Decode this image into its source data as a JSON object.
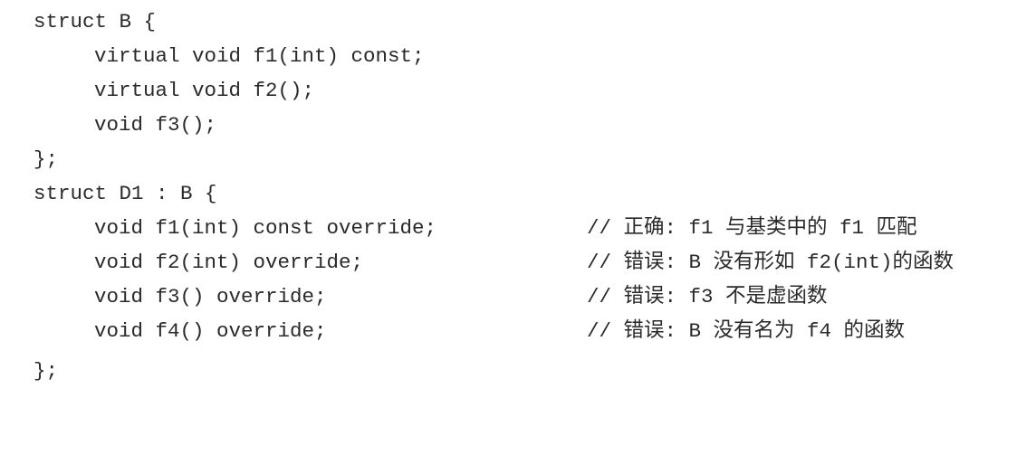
{
  "code": {
    "lines": [
      {
        "text": "struct B {",
        "comment": ""
      },
      {
        "text": "virtual void f1(int) const;",
        "comment": ""
      },
      {
        "text": "virtual void f2();",
        "comment": ""
      },
      {
        "text": "void f3();",
        "comment": ""
      },
      {
        "text": "};",
        "comment": ""
      },
      {
        "text": "struct D1 : B {",
        "comment": ""
      },
      {
        "text": "void f1(int) const override;",
        "comment": "// 正确: f1 与基类中的 f1 匹配"
      },
      {
        "text": "void f2(int) override;",
        "comment": "// 错误: B 没有形如 f2(int)的函数"
      },
      {
        "text": "void f3() override;",
        "comment": "// 错误: f3 不是虚函数"
      },
      {
        "text": "void f4() override;",
        "comment": "// 错误: B 没有名为 f4 的函数"
      },
      {
        "text": "};",
        "comment": ""
      }
    ]
  }
}
